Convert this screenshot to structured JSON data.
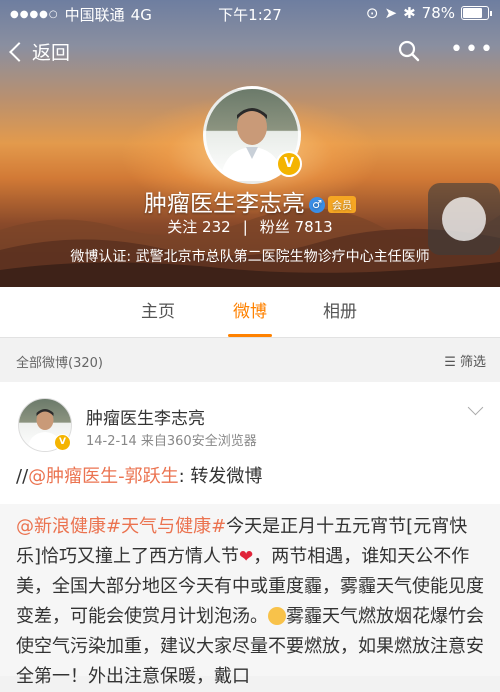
{
  "status_bar": {
    "carrier": "中国联通",
    "network": "4G",
    "time": "下午1:27",
    "battery": "78%"
  },
  "nav": {
    "back_label": "返回"
  },
  "profile": {
    "name": "肿瘤医生李志亮",
    "vip_label": "会员",
    "following_label": "关注",
    "following_count": "232",
    "followers_label": "粉丝",
    "followers_count": "7813",
    "verification_label": "微博认证:",
    "verification_text": "武警北京市总队第二医院生物诊疗中心主任医师"
  },
  "tabs": [
    {
      "label": "主页",
      "active": false
    },
    {
      "label": "微博",
      "active": true
    },
    {
      "label": "相册",
      "active": false
    }
  ],
  "filter": {
    "all_posts": "全部微博(320)",
    "filter_label": "筛选"
  },
  "post": {
    "author": "肿瘤医生李志亮",
    "date": "14-2-14",
    "source": "来自360安全浏览器",
    "repost_prefix": "//",
    "repost_mention": "@肿瘤医生-郭跃生",
    "repost_text": ": 转发微博",
    "quoted": {
      "mention": "@新浪健康",
      "hashtag": "#天气与健康#",
      "text1": "今天是正月十五元宵节[元宵快乐]恰巧又撞上了西方情人节",
      "text2": "，两节相遇，谁知天公不作美，全国大部分地区今天有中或重度霾，雾霾天气使能见度变差，可能会使赏月计划泡汤。",
      "text3": "雾霾天气燃放烟花爆竹会使空气污染加重，建议大家尽量不要燃放，如果燃放注意安全第一！外出注意保暖，戴口"
    }
  },
  "icons": {
    "back": "chevron-left-icon",
    "search": "search-icon",
    "more": "more-icon",
    "filter": "filter-icon",
    "verified": "verified-badge-icon",
    "gender": "male-icon",
    "heart": "heart-icon",
    "crying": "crying-face-icon"
  },
  "colors": {
    "accent": "#ff8200",
    "link": "#eb7350",
    "verified": "#f4b400"
  }
}
